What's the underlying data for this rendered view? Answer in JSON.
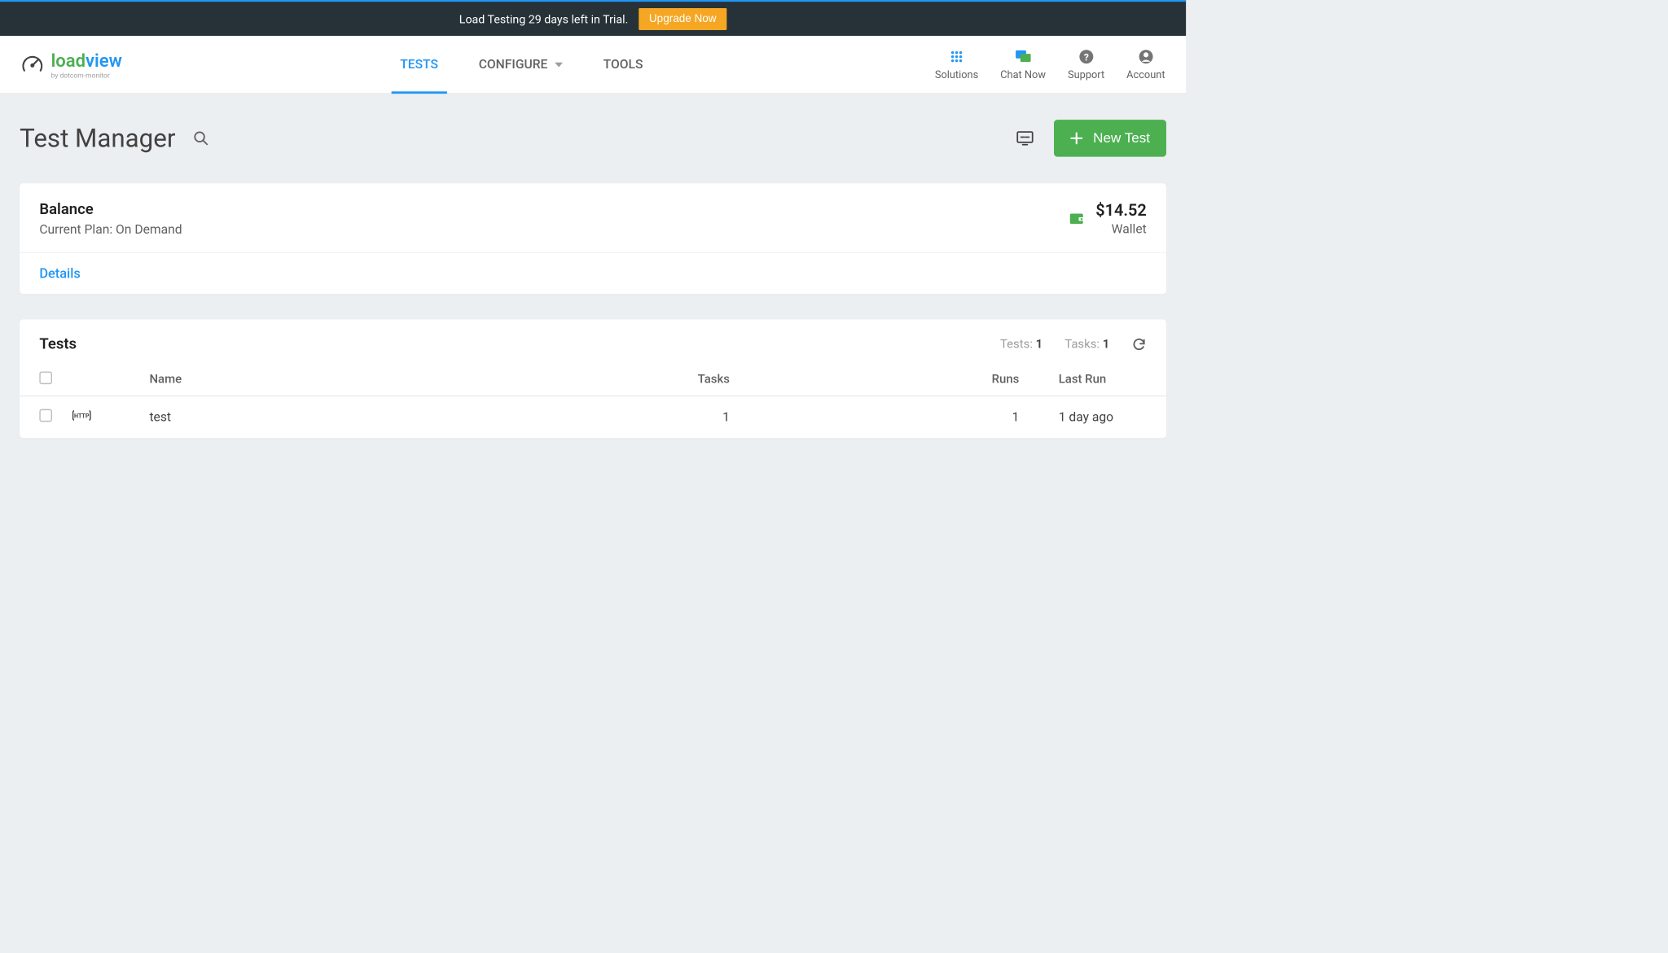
{
  "trial": {
    "message": "Load Testing 29 days left in Trial.",
    "upgrade_label": "Upgrade Now"
  },
  "logo": {
    "name_part1": "load",
    "name_part2": "view",
    "tagline": "by dotcom-monitor"
  },
  "nav": {
    "tabs": {
      "tests": "TESTS",
      "configure": "CONFIGURE",
      "tools": "TOOLS"
    },
    "icons": {
      "solutions": "Solutions",
      "chat": "Chat Now",
      "support": "Support",
      "account": "Account"
    }
  },
  "page": {
    "title": "Test Manager",
    "new_test_label": "New Test"
  },
  "balance": {
    "title": "Balance",
    "plan_prefix": "Current Plan: ",
    "plan_name": "On Demand",
    "amount": "$14.52",
    "wallet_label": "Wallet",
    "details_label": "Details"
  },
  "tests_section": {
    "title": "Tests",
    "tests_label": "Tests:",
    "tests_count": "1",
    "tasks_label": "Tasks:",
    "tasks_count": "1",
    "columns": {
      "name": "Name",
      "tasks": "Tasks",
      "runs": "Runs",
      "last_run": "Last Run"
    },
    "rows": [
      {
        "name": "test",
        "tasks": "1",
        "runs": "1",
        "last_run": "1 day ago"
      }
    ]
  }
}
